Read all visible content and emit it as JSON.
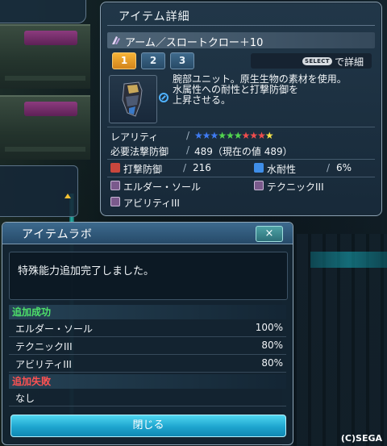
{
  "item_detail": {
    "title": "アイテム詳細",
    "item_name": "アーム／スロートクロー＋10",
    "tabs": [
      "1",
      "2",
      "3"
    ],
    "select_button": "SELECT",
    "select_hint": "で詳細",
    "description": [
      "腕部ユニット。原生生物の素材を使用。",
      "水属性への耐性と打撃防御を",
      "上昇させる。"
    ],
    "rarity_label": "レアリティ",
    "rarity_stars": 10,
    "star_colors": [
      "#3f7bf2",
      "#3f7bf2",
      "#3f7bf2",
      "#52d64f",
      "#52d64f",
      "#52d64f",
      "#f04d4d",
      "#f04d4d",
      "#f04d4d",
      "#f5e24a"
    ],
    "required_label": "必要法撃防御",
    "required_value": "489（現在の値 489）",
    "strike_def_label": "打撃防御",
    "strike_def_value": "216",
    "water_res_label": "水耐性",
    "water_res_value": "6%",
    "abilities": [
      "エルダー・ソール",
      "テクニックIII",
      "アビリティIII"
    ]
  },
  "item_lab": {
    "title": "アイテムラボ",
    "close_icon": "×",
    "message": "特殊能力追加完了しました。",
    "success_header": "追加成功",
    "success_rows": [
      {
        "name": "エルダー・ソール",
        "rate": "100%"
      },
      {
        "name": "テクニックIII",
        "rate": "80%"
      },
      {
        "name": "アビリティIII",
        "rate": "80%"
      }
    ],
    "fail_header": "追加失敗",
    "fail_rows": [
      {
        "name": "なし"
      }
    ],
    "close_button": "閉じる"
  },
  "copyright": "(C)SEGA"
}
